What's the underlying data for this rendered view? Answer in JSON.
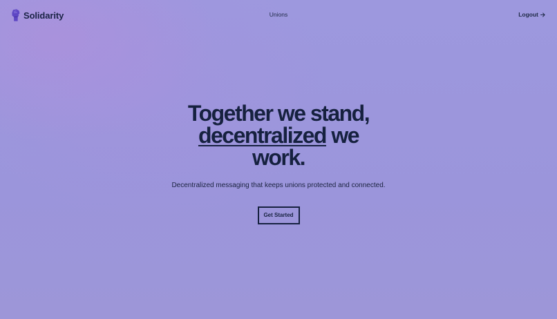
{
  "header": {
    "brand_name": "Solidarity",
    "brand_icon": "raised-fist-icon",
    "nav_unions": "Unions",
    "nav_logout": "Logout",
    "logout_icon": "arrow-right-icon"
  },
  "hero": {
    "title_part1": "Together we stand,",
    "title_underlined": "decentralized",
    "title_part2": "we work.",
    "subtitle": "Decentralized messaging that keeps unions protected and connected.",
    "cta_label": "Get Started"
  },
  "colors": {
    "background": "#9b96dc",
    "text": "#16213f",
    "brand_icon": "#5e47c4"
  }
}
